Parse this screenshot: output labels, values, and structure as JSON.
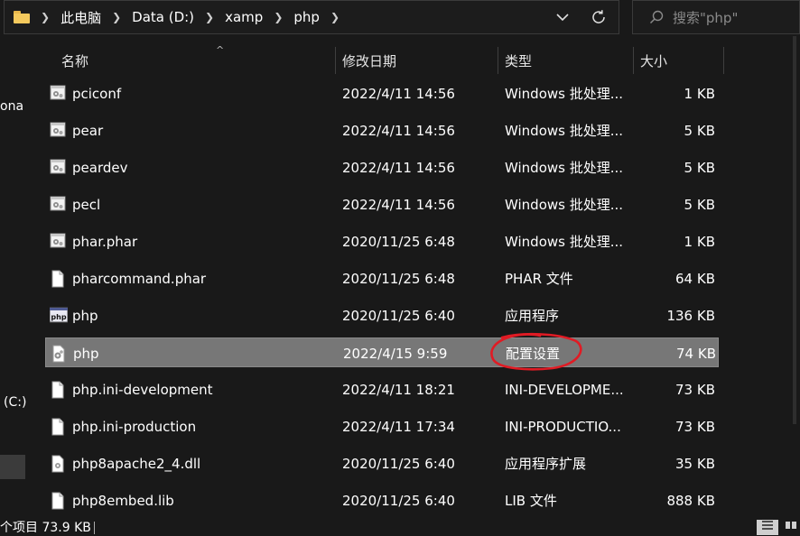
{
  "breadcrumb": [
    "此电脑",
    "Data (D:)",
    "xamp",
    "php"
  ],
  "search": {
    "placeholder": "搜索\"php\""
  },
  "sidebar": {
    "labels": [
      "ona",
      "(C:)"
    ]
  },
  "columns": {
    "name": "名称",
    "date": "修改日期",
    "type": "类型",
    "size": "大小"
  },
  "files": [
    {
      "name": "pciconf",
      "date": "2022/4/11 14:56",
      "type": "Windows 批处理...",
      "size": "1 KB",
      "icon": "batch-file-icon"
    },
    {
      "name": "pear",
      "date": "2022/4/11 14:56",
      "type": "Windows 批处理...",
      "size": "5 KB",
      "icon": "batch-file-icon"
    },
    {
      "name": "peardev",
      "date": "2022/4/11 14:56",
      "type": "Windows 批处理...",
      "size": "5 KB",
      "icon": "batch-file-icon"
    },
    {
      "name": "pecl",
      "date": "2022/4/11 14:56",
      "type": "Windows 批处理...",
      "size": "5 KB",
      "icon": "batch-file-icon"
    },
    {
      "name": "phar.phar",
      "date": "2020/11/25 6:48",
      "type": "Windows 批处理...",
      "size": "1 KB",
      "icon": "batch-file-icon"
    },
    {
      "name": "pharcommand.phar",
      "date": "2020/11/25 6:48",
      "type": "PHAR 文件",
      "size": "64 KB",
      "icon": "file-icon"
    },
    {
      "name": "php",
      "date": "2020/11/25 6:40",
      "type": "应用程序",
      "size": "136 KB",
      "icon": "php-exe-icon"
    },
    {
      "name": "php",
      "date": "2022/4/15 9:59",
      "type": "配置设置",
      "size": "74 KB",
      "icon": "config-file-icon",
      "selected": true
    },
    {
      "name": "php.ini-development",
      "date": "2022/4/11 18:21",
      "type": "INI-DEVELOPME...",
      "size": "73 KB",
      "icon": "file-icon"
    },
    {
      "name": "php.ini-production",
      "date": "2022/4/11 17:34",
      "type": "INI-PRODUCTIO...",
      "size": "73 KB",
      "icon": "file-icon"
    },
    {
      "name": "php8apache2_4.dll",
      "date": "2020/11/25 6:40",
      "type": "应用程序扩展",
      "size": "35 KB",
      "icon": "dll-file-icon"
    },
    {
      "name": "php8embed.lib",
      "date": "2020/11/25 6:40",
      "type": "LIB 文件",
      "size": "888 KB",
      "icon": "file-icon"
    }
  ],
  "status": {
    "text": "个项目 73.9 KB"
  },
  "colors": {
    "annotation": "#e01b24",
    "selected_row": "#777777",
    "folder": "#f4c95d"
  }
}
